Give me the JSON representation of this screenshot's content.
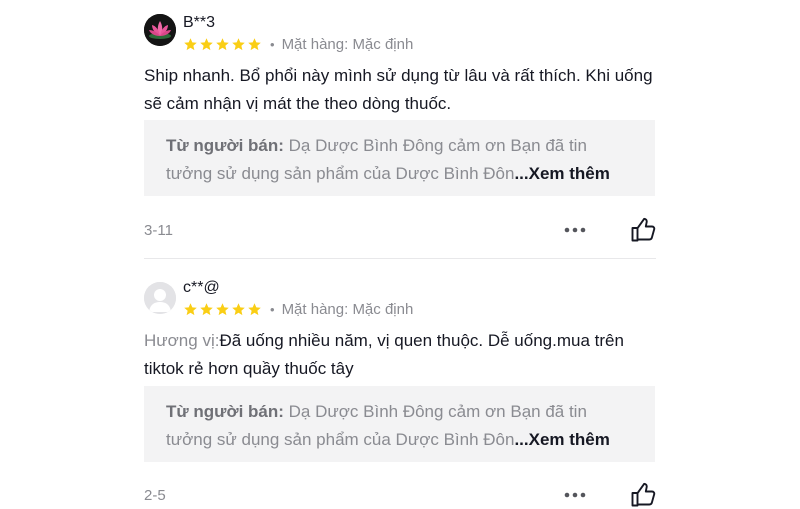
{
  "reviews": [
    {
      "username": "B**3",
      "rating": 5,
      "variant_label": "Mặt hàng: Mặc định",
      "text_prefix": "",
      "text": "Ship nhanh. Bổ phổi này mình sử dụng từ lâu và rất thích. Khi uống sẽ cảm nhận vị mát the theo dòng thuốc.",
      "seller_reply_label": "Từ người bán:",
      "seller_reply": " Dạ Dược Bình Đông cảm ơn Bạn đã tin tưởng sử dụng sản phẩm của Dược Bình Đôn",
      "see_more": "...Xem thêm",
      "date": "3-11",
      "avatar_icon": "lotus-flower-icon"
    },
    {
      "username": "c**@",
      "rating": 5,
      "variant_label": "Mặt hàng: Mặc định",
      "text_prefix": "Hương vị:",
      "text": "Đã uống nhiều năm, vị quen thuộc. Dễ uống.mua trên tiktok rẻ hơn quầy thuốc tây",
      "seller_reply_label": "Từ người bán:",
      "seller_reply": " Dạ Dược Bình Đông cảm ơn Bạn đã tin tưởng sử dụng sản phẩm của Dược Bình Đôn",
      "see_more": "...Xem thêm",
      "date": "2-5",
      "avatar_icon": "default-user-icon"
    }
  ],
  "colors": {
    "star": "#FACE15",
    "text": "#161823",
    "muted": "#8A8B91",
    "reply_bg": "#F3F3F4"
  }
}
